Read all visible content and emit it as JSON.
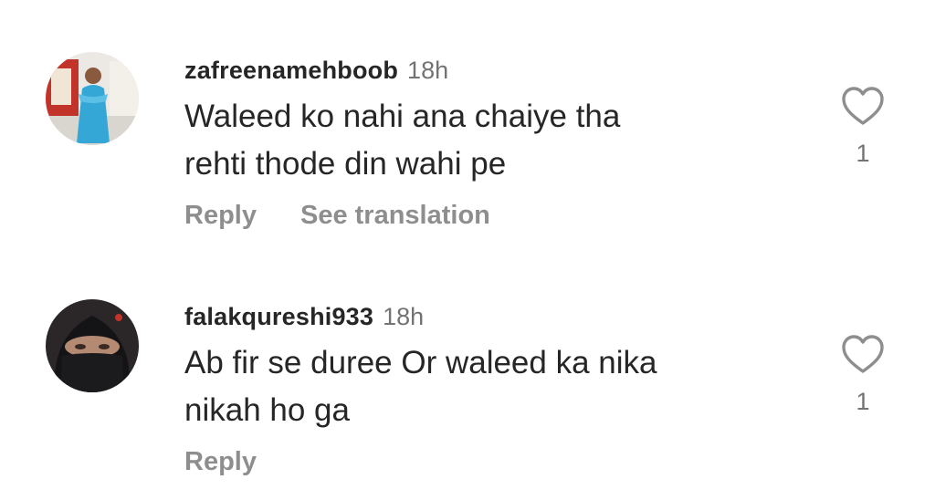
{
  "comments": [
    {
      "username": "zafreenamehboob",
      "timestamp": "18h",
      "text_lines": [
        "Waleed ko nahi ana chaiye tha",
        "rehti thode din wahi pe"
      ],
      "actions": {
        "reply": "Reply",
        "translate": "See translation"
      },
      "likes": "1",
      "avatar": {
        "bg": "#e9e6e1",
        "dress": "#35a7d6",
        "accent": "#c2332a"
      }
    },
    {
      "username": "falakqureshi933",
      "timestamp": "18h",
      "text_lines": [
        "Ab fir se duree Or waleed ka nika",
        "nikah ho ga"
      ],
      "actions": {
        "reply": "Reply"
      },
      "likes": "1",
      "avatar": {
        "bg": "#2b2628",
        "veil": "#17171a",
        "skin": "#b58a72"
      }
    }
  ]
}
